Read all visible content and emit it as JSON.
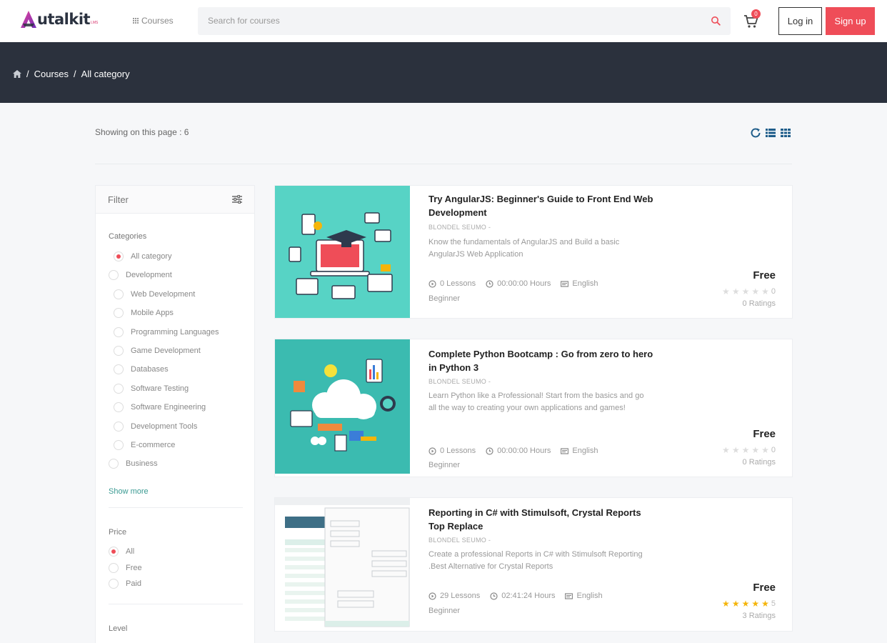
{
  "brand": {
    "name": "utalkit",
    "sub": "LMS",
    "accent": "#d6336c"
  },
  "header": {
    "courses_label": "Courses",
    "search_placeholder": "Search for courses",
    "cart_count": "0",
    "login_label": "Log in",
    "signup_label": "Sign up"
  },
  "breadcrumb": {
    "items": [
      "Courses",
      "All category"
    ]
  },
  "listing": {
    "showing_text": "Showing on this page : 6"
  },
  "filter": {
    "title": "Filter",
    "categories_title": "Categories",
    "categories": [
      {
        "label": "All category",
        "selected": true,
        "indent": 0
      },
      {
        "label": "Development",
        "selected": false,
        "indent": 0
      },
      {
        "label": "Web Development",
        "selected": false,
        "indent": 1
      },
      {
        "label": "Mobile Apps",
        "selected": false,
        "indent": 1
      },
      {
        "label": "Programming Languages",
        "selected": false,
        "indent": 1
      },
      {
        "label": "Game Development",
        "selected": false,
        "indent": 1
      },
      {
        "label": "Databases",
        "selected": false,
        "indent": 1
      },
      {
        "label": "Software Testing",
        "selected": false,
        "indent": 1
      },
      {
        "label": "Software Engineering",
        "selected": false,
        "indent": 1
      },
      {
        "label": "Development Tools",
        "selected": false,
        "indent": 1
      },
      {
        "label": "E-commerce",
        "selected": false,
        "indent": 1
      },
      {
        "label": "Business",
        "selected": false,
        "indent": 0
      }
    ],
    "show_more": "Show more",
    "price_title": "Price",
    "prices": [
      {
        "label": "All",
        "selected": true
      },
      {
        "label": "Free",
        "selected": false
      },
      {
        "label": "Paid",
        "selected": false
      }
    ],
    "level_title": "Level"
  },
  "courses": [
    {
      "title": "Try AngularJS: Beginner's Guide to Front End Web Development",
      "author": "BLONDEL SEUMO -",
      "description": "Know the fundamentals of AngularJS and Build a basic AngularJS Web Application",
      "lessons": "0 Lessons",
      "duration": "00:00:00 Hours",
      "language": "English",
      "level": "Beginner",
      "price": "Free",
      "rating_value": 0,
      "rating_label": "0",
      "ratings_count": "0 Ratings"
    },
    {
      "title": "Complete Python Bootcamp : Go from zero to hero in Python 3",
      "author": "BLONDEL SEUMO -",
      "description": "Learn Python like a Professional! Start from the basics and go all the way to creating your own applications and games!",
      "lessons": "0 Lessons",
      "duration": "00:00:00 Hours",
      "language": "English",
      "level": "Beginner",
      "price": "Free",
      "rating_value": 0,
      "rating_label": "0",
      "ratings_count": "0 Ratings"
    },
    {
      "title": "Reporting in C# with Stimulsoft, Crystal Reports Top Replace",
      "author": "BLONDEL SEUMO -",
      "description": "Create a professional Reports in C# with Stimulsoft Reporting .Best Alternative for Crystal Reports",
      "lessons": "29 Lessons",
      "duration": "02:41:24 Hours",
      "language": "English",
      "level": "Beginner",
      "price": "Free",
      "rating_value": 5,
      "rating_label": "5",
      "ratings_count": "3 Ratings"
    }
  ],
  "colors": {
    "primary": "#ef4d58",
    "band": "#2b313d",
    "teal": "#3a9a92",
    "star": "#f5b50a"
  }
}
